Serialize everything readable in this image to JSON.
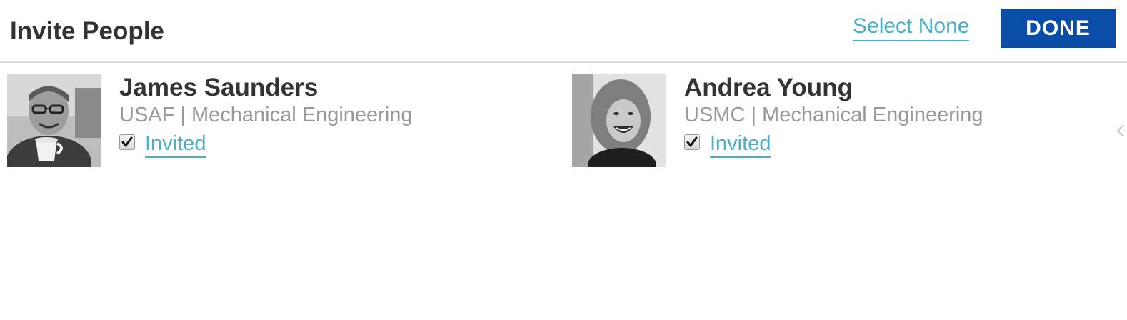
{
  "header": {
    "title": "Invite People",
    "select_none_label": "Select None",
    "done_label": "DONE"
  },
  "people": [
    {
      "name": "James Saunders",
      "affiliation": "USAF | Mechanical Engineering",
      "status": "Invited",
      "checked": true
    },
    {
      "name": "Andrea Young",
      "affiliation": "USMC | Mechanical Engineering",
      "status": "Invited",
      "checked": true
    }
  ],
  "colors": {
    "accent_link": "#4ab0c8",
    "done_button": "#0a4da8",
    "text_dark": "#333333",
    "text_muted": "#999999"
  },
  "icons": {
    "checkbox": "checkmark-icon",
    "edge": "chevron-left-icon"
  }
}
